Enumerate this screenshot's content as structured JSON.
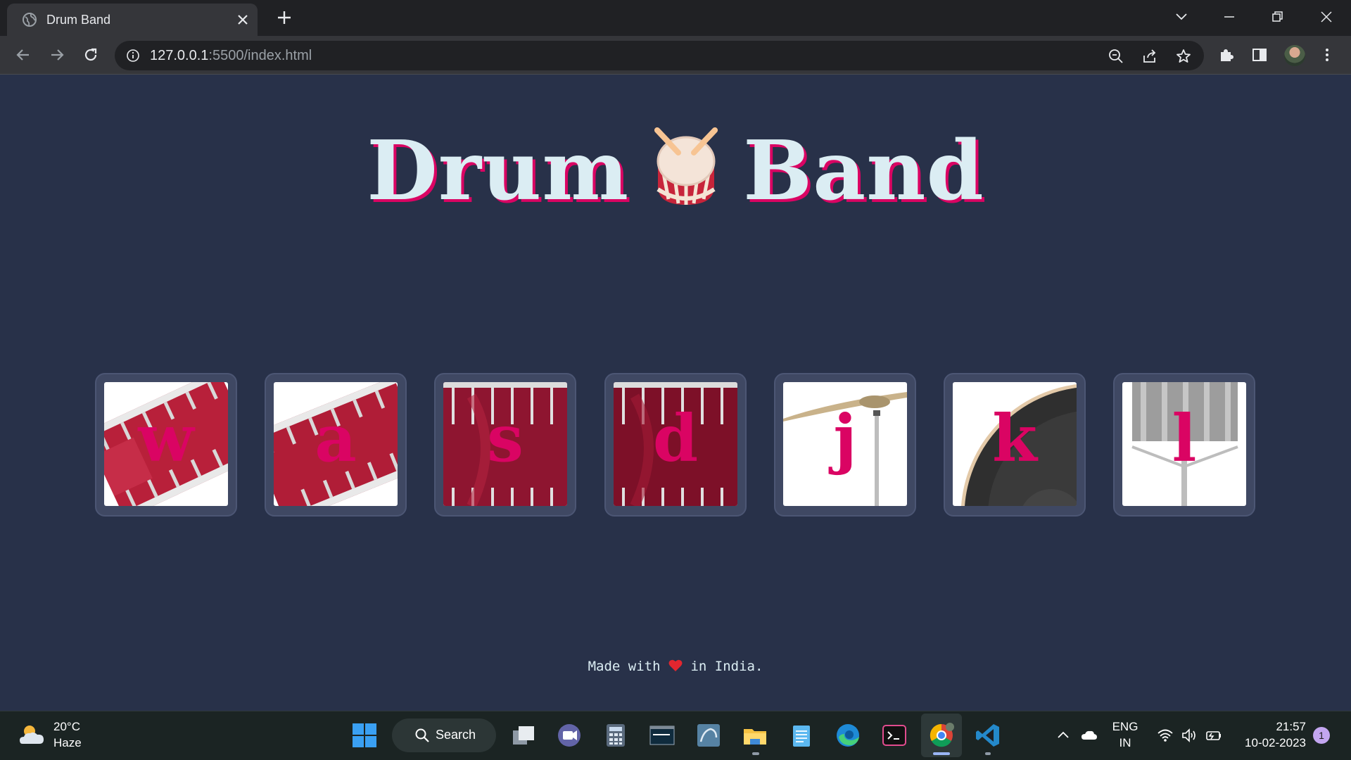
{
  "browser": {
    "tab_title": "Drum Band",
    "url_host": "127.0.0.1",
    "url_rest": ":5500/index.html"
  },
  "page": {
    "title_left": "Drum",
    "title_right": "Band",
    "title_emoji": "drum-icon",
    "keys": [
      {
        "letter": "w",
        "image": "tom-1"
      },
      {
        "letter": "a",
        "image": "tom-2"
      },
      {
        "letter": "s",
        "image": "tom-3"
      },
      {
        "letter": "d",
        "image": "tom-4"
      },
      {
        "letter": "j",
        "image": "snare-cymbal"
      },
      {
        "letter": "k",
        "image": "crash"
      },
      {
        "letter": "l",
        "image": "kick-bass"
      }
    ],
    "footer_before": "Made with",
    "footer_after": "in India."
  },
  "colors": {
    "background": "#283149",
    "accent": "#da0463",
    "title_text": "#dbedf3",
    "key_frame": "#3f4863"
  },
  "taskbar": {
    "weather_temp": "20°C",
    "weather_condition": "Haze",
    "search_label": "Search",
    "language": "ENG",
    "region": "IN",
    "time": "21:57",
    "date": "10-02-2023",
    "notification_count": "1"
  }
}
